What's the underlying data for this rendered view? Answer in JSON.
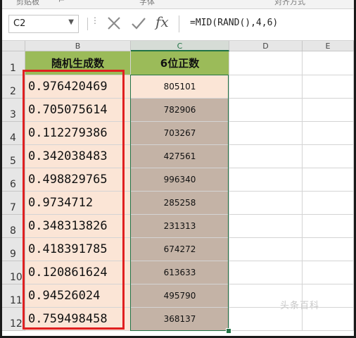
{
  "ribbon": {
    "groups": [
      "剪贴板",
      "字体",
      "对齐方式"
    ]
  },
  "formula_bar": {
    "name_box": "C2",
    "formula": "=MID(RAND(),4,6)",
    "icons": [
      "cancel-icon",
      "enter-icon",
      "function-icon"
    ]
  },
  "columns": [
    "B",
    "C",
    "D",
    "E"
  ],
  "rows": [
    "1",
    "2",
    "3",
    "4",
    "5",
    "6",
    "7",
    "8",
    "9",
    "10",
    "11",
    "12"
  ],
  "header": {
    "b": "随机生成数",
    "c": "6位正数"
  },
  "data": [
    {
      "b": "0.976420469",
      "c": "805101"
    },
    {
      "b": "0.705075614",
      "c": "782906"
    },
    {
      "b": "0.112279386",
      "c": "703267"
    },
    {
      "b": "0.342038483",
      "c": "427561"
    },
    {
      "b": "0.498829765",
      "c": "996340"
    },
    {
      "b": "0.9734712",
      "c": "285258"
    },
    {
      "b": "0.348313826",
      "c": "231313"
    },
    {
      "b": "0.418391785",
      "c": "674272"
    },
    {
      "b": "0.120861624",
      "c": "613633"
    },
    {
      "b": "0.94526024",
      "c": "495790"
    },
    {
      "b": "0.759498458",
      "c": "368137"
    }
  ],
  "watermark": "头条百科",
  "colors": {
    "header_fill": "#9bbb59",
    "b_fill": "#fbe5d6",
    "c_fill": "#c4b3a6",
    "highlight_box": "#e02020",
    "selection": "#217346"
  }
}
